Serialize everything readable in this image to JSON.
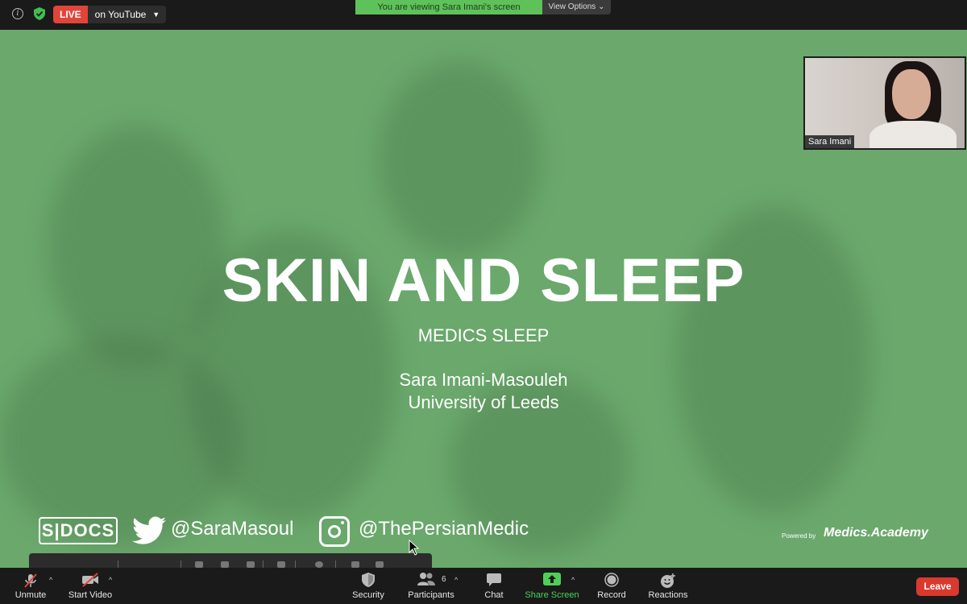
{
  "top_bar": {
    "live_badge": "LIVE",
    "live_destination": "on YouTube",
    "viewing_banner": "You are viewing Sara Imani's screen",
    "view_options": "View Options"
  },
  "slide": {
    "title": "SKIN AND SLEEP",
    "subtitle": "MEDICS SLEEP",
    "author_name": "Sara Imani-Masouleh",
    "author_institution": "University of Leeds",
    "sdocs_logo": "S|DOCS",
    "twitter_handle": "@SaraMasoul",
    "instagram_handle": "@ThePersianMedic",
    "powered_by": "Powered by",
    "academy_logo": "Medics.Academy"
  },
  "video_tile": {
    "participant_name": "Sara Imani"
  },
  "toolbar": {
    "unmute": "Unmute",
    "start_video": "Start Video",
    "security": "Security",
    "participants": "Participants",
    "participants_count": "6",
    "chat": "Chat",
    "share_screen": "Share Screen",
    "record": "Record",
    "reactions": "Reactions",
    "leave": "Leave"
  },
  "colors": {
    "slide_bg": "#6aa86c",
    "live_red": "#e0453a",
    "banner_green": "#5fc15a",
    "share_green": "#4fcf5a",
    "leave_red": "#d9392e"
  },
  "icons": [
    "info-icon",
    "shield-check-icon",
    "twitter-icon",
    "instagram-icon",
    "mic-muted-icon",
    "video-muted-icon",
    "security-shield-icon",
    "participants-icon",
    "chat-icon",
    "share-screen-icon",
    "record-icon",
    "reactions-icon"
  ]
}
